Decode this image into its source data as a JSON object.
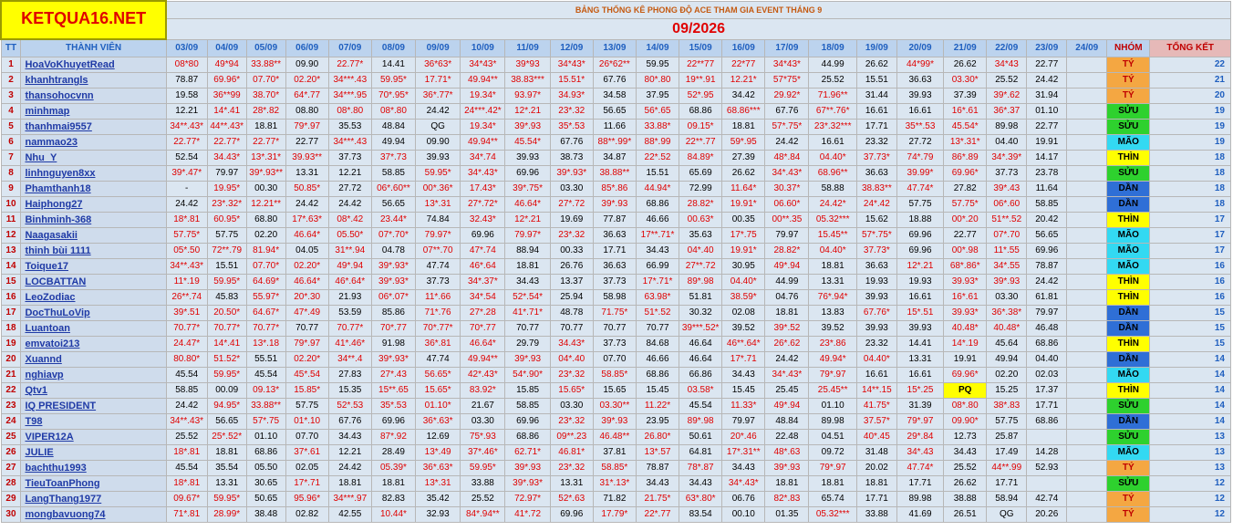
{
  "logo": "KETQUA16.NET",
  "subtitle": "BẢNG THỐNG KÊ PHONG ĐỘ ACE THAM GIA EVENT THÁNG 9",
  "month": "09/2026",
  "headers": {
    "tt": "TT",
    "member": "THÀNH VIÊN",
    "dates": [
      "03/09",
      "04/09",
      "05/09",
      "06/09",
      "07/09",
      "08/09",
      "09/09",
      "10/09",
      "11/09",
      "12/09",
      "13/09",
      "14/09",
      "15/09",
      "16/09",
      "17/09",
      "18/09",
      "19/09",
      "20/09",
      "21/09",
      "22/09",
      "23/09",
      "24/09"
    ],
    "group": "NHÓM",
    "total": "TỔNG KẾT"
  },
  "group_colors": {
    "TÝ": "#f4a742",
    "SỬU": "#2ed12e",
    "MÃO": "#33d9f2",
    "THÌN": "#ffff00",
    "DẦN": "#2f6fd6"
  },
  "rows": [
    {
      "tt": "1",
      "name": "HoaVoKhuyetRead",
      "cells": [
        "08*80",
        "49*94",
        "33.88**",
        "09.90",
        "22.77*",
        "14.41",
        "36*63*",
        "34*43*",
        "39*93",
        "34*43*",
        "26*62**",
        "59.95",
        "22**77",
        "22*77",
        "34*43*",
        "44.99",
        "26.62",
        "44*99*",
        "26.62",
        "34*43",
        "22.77",
        ""
      ],
      "group": "TÝ",
      "total": "22"
    },
    {
      "tt": "2",
      "name": "khanhtrangls",
      "cells": [
        "78.87",
        "69.96*",
        "07.70*",
        "02.20*",
        "34***.43",
        "59.95*",
        "17.71*",
        "49.94**",
        "38.83***",
        "15.51*",
        "67.76",
        "80*.80",
        "19**.91",
        "12.21*",
        "57*75*",
        "25.52",
        "15.51",
        "36.63",
        "03.30*",
        "25.52",
        "24.42",
        ""
      ],
      "group": "TÝ",
      "total": "21"
    },
    {
      "tt": "3",
      "name": "thansohocvnn",
      "cells": [
        "19.58",
        "36**99",
        "38.70*",
        "64*.77",
        "34***.95",
        "70*.95*",
        "36*.77*",
        "19.34*",
        "93.97*",
        "34.93*",
        "34.58",
        "37.95",
        "52*.95",
        "34.42",
        "29.92*",
        "71.96**",
        "31.44",
        "39.93",
        "37.39",
        "39*.62",
        "31.94",
        ""
      ],
      "group": "TÝ",
      "total": "20"
    },
    {
      "tt": "4",
      "name": "minhmap",
      "cells": [
        "12.21",
        "14*.41",
        "28*.82",
        "08.80",
        "08*.80",
        "08*.80",
        "24.42",
        "24***.42*",
        "12*.21",
        "23*.32",
        "56.65",
        "56*.65",
        "68.86",
        "68.86***",
        "67.76",
        "67**.76*",
        "16.61",
        "16.61",
        "16*.61",
        "36*.37",
        "01.10",
        ""
      ],
      "group": "SỬU",
      "total": "19"
    },
    {
      "tt": "5",
      "name": "thanhmai9557",
      "cells": [
        "34**.43*",
        "44**.43*",
        "18.81",
        "79*.97",
        "35.53",
        "48.84",
        "QG",
        "19.34*",
        "39*.93",
        "35*.53",
        "11.66",
        "33.88*",
        "09.15*",
        "18.81",
        "57*.75*",
        "23*.32***",
        "17.71",
        "35**.53",
        "45.54*",
        "89.98",
        "22.77",
        ""
      ],
      "group": "SỬU",
      "total": "19"
    },
    {
      "tt": "6",
      "name": "nammao23",
      "cells": [
        "22.77*",
        "22.77*",
        "22.77*",
        "22.77",
        "34***.43",
        "49.94",
        "09.90",
        "49.94**",
        "45.54*",
        "67.76",
        "88**.99*",
        "88*.99",
        "22**.77",
        "59*.95",
        "24.42",
        "16.61",
        "23.32",
        "27.72",
        "13*.31*",
        "04.40",
        "19.91",
        ""
      ],
      "group": "MÃO",
      "total": "19"
    },
    {
      "tt": "7",
      "name": "Nhu_Y",
      "cells": [
        "52.54",
        "34.43*",
        "13*.31*",
        "39.93**",
        "37.73",
        "37*.73",
        "39.93",
        "34*.74",
        "39.93",
        "38.73",
        "34.87",
        "22*.52",
        "84.89*",
        "27.39",
        "48*.84",
        "04.40*",
        "37.73*",
        "74*.79",
        "86*.89",
        "34*.39*",
        "14.17",
        ""
      ],
      "group": "THÌN",
      "total": "18"
    },
    {
      "tt": "8",
      "name": "linhnguyen8xx",
      "cells": [
        "39*.47*",
        "79.97",
        "39*.93**",
        "13.31",
        "12.21",
        "58.85",
        "59.95*",
        "34*.43*",
        "69.96",
        "39*.93*",
        "38.88**",
        "15.51",
        "65.69",
        "26.62",
        "34*.43*",
        "68.96**",
        "36.63",
        "39.99*",
        "69.96*",
        "37.73",
        "23.78",
        ""
      ],
      "group": "SỬU",
      "total": "18"
    },
    {
      "tt": "9",
      "name": "Phamthanh18",
      "cells": [
        "-",
        "19.95*",
        "00.30",
        "50.85*",
        "27.72",
        "06*.60**",
        "00*.36*",
        "17.43*",
        "39*.75*",
        "03.30",
        "85*.86",
        "44.94*",
        "72.99",
        "11.64*",
        "30.37*",
        "58.88",
        "38.83**",
        "47.74*",
        "27.82",
        "39*.43",
        "11.64",
        ""
      ],
      "group": "DẦN",
      "total": "18"
    },
    {
      "tt": "10",
      "name": "Haiphong27",
      "cells": [
        "24.42",
        "23*.32*",
        "12.21**",
        "24.42",
        "24.42",
        "56.65",
        "13*.31",
        "27*.72*",
        "46.64*",
        "27*.72",
        "39*.93",
        "68.86",
        "28.82*",
        "19.91*",
        "06.60*",
        "24.42*",
        "24*.42",
        "57.75",
        "57.75*",
        "06*.60",
        "58.85",
        ""
      ],
      "group": "DẦN",
      "total": "18"
    },
    {
      "tt": "11",
      "name": "Binhminh-368",
      "cells": [
        "18*.81",
        "60.95*",
        "68.80",
        "17*.63*",
        "08*.42",
        "23.44*",
        "74.84",
        "32.43*",
        "12*.21",
        "19.69",
        "77.87",
        "46.66",
        "00.63*",
        "00.35",
        "00**.35",
        "05.32***",
        "15.62",
        "18.88",
        "00*.20",
        "51**.52",
        "20.42",
        ""
      ],
      "group": "THÌN",
      "total": "17"
    },
    {
      "tt": "12",
      "name": "Naagasakii",
      "cells": [
        "57.75*",
        "57.75",
        "02.20",
        "46.64*",
        "05.50*",
        "07*.70*",
        "79.97*",
        "69.96",
        "79.97*",
        "23*.32",
        "36.63",
        "17**.71*",
        "35.63",
        "17*.75",
        "79.97",
        "15.45**",
        "57*.75*",
        "69.96",
        "22.77",
        "07*.70",
        "56.65",
        ""
      ],
      "group": "MÃO",
      "total": "17"
    },
    {
      "tt": "13",
      "name": "thinh bùi 1111",
      "cells": [
        "05*.50",
        "72**.79",
        "81.94*",
        "04.05",
        "31**.94",
        "04.78",
        "07**.70",
        "47*.74",
        "88.94",
        "00.33",
        "17.71",
        "34.43",
        "04*.40",
        "19.91*",
        "28.82*",
        "04.40*",
        "37.73*",
        "69.96",
        "00*.98",
        "11*.55",
        "69.96",
        ""
      ],
      "group": "MÃO",
      "total": "17"
    },
    {
      "tt": "14",
      "name": "Toique17",
      "cells": [
        "34**.43*",
        "15.51",
        "07.70*",
        "02.20*",
        "49*.94",
        "39*.93*",
        "47.74",
        "46*.64",
        "18.81",
        "26.76",
        "36.63",
        "66.99",
        "27**.72",
        "30.95",
        "49*.94",
        "18.81",
        "36.63",
        "12*.21",
        "68*.86*",
        "34*.55",
        "78.87",
        ""
      ],
      "group": "MÃO",
      "total": "16"
    },
    {
      "tt": "15",
      "name": "LOCBATTAN",
      "cells": [
        "11*.19",
        "59.95*",
        "64.69*",
        "46.64*",
        "46*.64*",
        "39*.93*",
        "37.73",
        "34*.37*",
        "34.43",
        "13.37",
        "37.73",
        "17*.71*",
        "89*.98",
        "04.40*",
        "44.99",
        "13.31",
        "19.93",
        "19.93",
        "39.93*",
        "39*.93",
        "24.42",
        ""
      ],
      "group": "THÌN",
      "total": "16"
    },
    {
      "tt": "16",
      "name": "LeoZodiac",
      "cells": [
        "26**.74",
        "45.83",
        "55.97*",
        "20*.30",
        "21.93",
        "06*.07*",
        "11*.66",
        "34*.54",
        "52*.54*",
        "25.94",
        "58.98",
        "63.98*",
        "51.81",
        "38.59*",
        "04.76",
        "76*.94*",
        "39.93",
        "16.61",
        "16*.61",
        "03.30",
        "61.81",
        ""
      ],
      "group": "THÌN",
      "total": "16"
    },
    {
      "tt": "17",
      "name": "DocThuLoVip",
      "cells": [
        "39*.51",
        "20.50*",
        "64.67*",
        "47*.49",
        "53.59",
        "85.86",
        "71*.76",
        "27*.28",
        "41*.71*",
        "48.78",
        "71.75*",
        "51*.52",
        "30.32",
        "02.08",
        "18.81",
        "13.83",
        "67.76*",
        "15*.51",
        "39.93*",
        "36*.38*",
        "79.97",
        ""
      ],
      "group": "DẦN",
      "total": "15"
    },
    {
      "tt": "18",
      "name": "Luantoan",
      "cells": [
        "70.77*",
        "70.77*",
        "70.77*",
        "70.77",
        "70.77*",
        "70*.77",
        "70*.77*",
        "70*.77",
        "70.77",
        "70.77",
        "70.77",
        "70.77",
        "39***.52*",
        "39.52",
        "39*.52",
        "39.52",
        "39.93",
        "39.93",
        "40.48*",
        "40.48*",
        "46.48",
        ""
      ],
      "group": "DẦN",
      "total": "15"
    },
    {
      "tt": "19",
      "name": "emvatoi213",
      "cells": [
        "24.47*",
        "14*.41",
        "13*.18",
        "79*.97",
        "41*.46*",
        "91.98",
        "36*.81",
        "46.64*",
        "29.79",
        "34.43*",
        "37.73",
        "84.68",
        "46.64",
        "46**.64*",
        "26*.62",
        "23*.86",
        "23.32",
        "14.41",
        "14*.19",
        "45.64",
        "68.86",
        ""
      ],
      "group": "THÌN",
      "total": "15"
    },
    {
      "tt": "20",
      "name": "Xuannd",
      "cells": [
        "80.80*",
        "51.52*",
        "55.51",
        "02.20*",
        "34**.4",
        "39*.93*",
        "47.74",
        "49.94**",
        "39*.93",
        "04*.40",
        "07.70",
        "46.66",
        "46.64",
        "17*.71",
        "24.42",
        "49.94*",
        "04.40*",
        "13.31",
        "19.91",
        "49.94",
        "04.40",
        ""
      ],
      "group": "DẦN",
      "total": "14"
    },
    {
      "tt": "21",
      "name": "nghiavp",
      "cells": [
        "45.54",
        "59.95*",
        "45.54",
        "45*.54",
        "27.83",
        "27*.43",
        "56.65*",
        "42*.43*",
        "54*.90*",
        "23*.32",
        "58.85*",
        "68.86",
        "66.86",
        "34.43",
        "34*.43*",
        "79*.97",
        "16.61",
        "16.61",
        "69.96*",
        "02.20",
        "02.03",
        ""
      ],
      "group": "MÃO",
      "total": "14"
    },
    {
      "tt": "22",
      "name": "Qtv1",
      "cells": [
        "58.85",
        "00.09",
        "09.13*",
        "15.85*",
        "15.35",
        "15**.65",
        "15.65*",
        "83.92*",
        "15.85",
        "15.65*",
        "15.65",
        "15.45",
        "03.58*",
        "15.45",
        "25.45",
        "25.45**",
        "14**.15",
        "15*.25",
        "PQ",
        "15.25",
        "17.37",
        ""
      ],
      "group": "THÌN",
      "total": "14"
    },
    {
      "tt": "23",
      "name": "IQ PRESIDENT",
      "cells": [
        "24.42",
        "94.95*",
        "33.88**",
        "57.75",
        "52*.53",
        "35*.53",
        "01.10*",
        "21.67",
        "58.85",
        "03.30",
        "03.30**",
        "11.22*",
        "45.54",
        "11.33*",
        "49*.94",
        "01.10",
        "41.75*",
        "31.39",
        "08*.80",
        "38*.83",
        "17.71",
        ""
      ],
      "group": "SỬU",
      "total": "14"
    },
    {
      "tt": "24",
      "name": "T98",
      "cells": [
        "34**.43*",
        "56.65",
        "57*.75",
        "01*.10",
        "67.76",
        "69.96",
        "36*.63*",
        "03.30",
        "69.96",
        "23*.32",
        "39*.93",
        "23.95",
        "89*.98",
        "79.97",
        "48.84",
        "89.98",
        "37.57*",
        "79*.97",
        "09.90*",
        "57.75",
        "68.86",
        ""
      ],
      "group": "DẦN",
      "total": "14"
    },
    {
      "tt": "25",
      "name": "VIPER12A",
      "cells": [
        "25.52",
        "25*.52*",
        "01.10",
        "07.70",
        "34.43",
        "87*.92",
        "12.69",
        "75*.93",
        "68.86",
        "09**.23",
        "46.48**",
        "26.80*",
        "50.61",
        "20*.46",
        "22.48",
        "04.51",
        "40*.45",
        "29*.84",
        "12.73",
        "25.87",
        ""
      ],
      "group": "SỬU",
      "total": "13"
    },
    {
      "tt": "26",
      "name": "JULIE",
      "cells": [
        "18*.81",
        "18.81",
        "68.86",
        "37*.61",
        "12.21",
        "28.49",
        "13*.49",
        "37*.46*",
        "62.71*",
        "46.81*",
        "37.81",
        "13*.57",
        "64.81",
        "17*.31**",
        "48*.63",
        "09.72",
        "31.48",
        "34*.43",
        "34.43",
        "17.49",
        "14.28",
        ""
      ],
      "group": "MÃO",
      "total": "13"
    },
    {
      "tt": "27",
      "name": "bachthu1993",
      "cells": [
        "45.54",
        "35.54",
        "05.50",
        "02.05",
        "24.42",
        "05.39*",
        "36*.63*",
        "59.95*",
        "39*.93",
        "23*.32",
        "58.85*",
        "78.87",
        "78*.87",
        "34.43",
        "39*.93",
        "79*.97",
        "20.02",
        "47.74*",
        "25.52",
        "44**.99",
        "52.93",
        ""
      ],
      "group": "TÝ",
      "total": "13"
    },
    {
      "tt": "28",
      "name": "TieuToanPhong",
      "cells": [
        "18*.81",
        "13.31",
        "30.65",
        "17*.71",
        "18.81",
        "18.81",
        "13*.31",
        "33.88",
        "39*.93*",
        "13.31",
        "31*.13*",
        "34.43",
        "34.43",
        "34*.43*",
        "18.81",
        "18.81",
        "18.81",
        "17.71",
        "26.62",
        "17.71",
        ""
      ],
      "group": "SỬU",
      "total": "12"
    },
    {
      "tt": "29",
      "name": "LangThang1977",
      "cells": [
        "09.67*",
        "59.95*",
        "50.65",
        "95.96*",
        "34***.97",
        "82.83",
        "35.42",
        "25.52",
        "72.97*",
        "52*.63",
        "71.82",
        "21.75*",
        "63*.80*",
        "06.76",
        "82*.83",
        "65.74",
        "17.71",
        "89.98",
        "38.88",
        "58.94",
        "42.74",
        ""
      ],
      "group": "TÝ",
      "total": "12"
    },
    {
      "tt": "30",
      "name": "mongbavuong74",
      "cells": [
        "71*.81",
        "28.99*",
        "38.48",
        "02.82",
        "42.55",
        "10.44*",
        "32.93",
        "84*.94**",
        "41*.72",
        "69.96",
        "17.79*",
        "22*.77",
        "83.54",
        "00.10",
        "01.35",
        "05.32***",
        "33.88",
        "41.69",
        "26.51",
        "QG",
        "20.26",
        ""
      ],
      "group": "TÝ",
      "total": "12"
    }
  ]
}
